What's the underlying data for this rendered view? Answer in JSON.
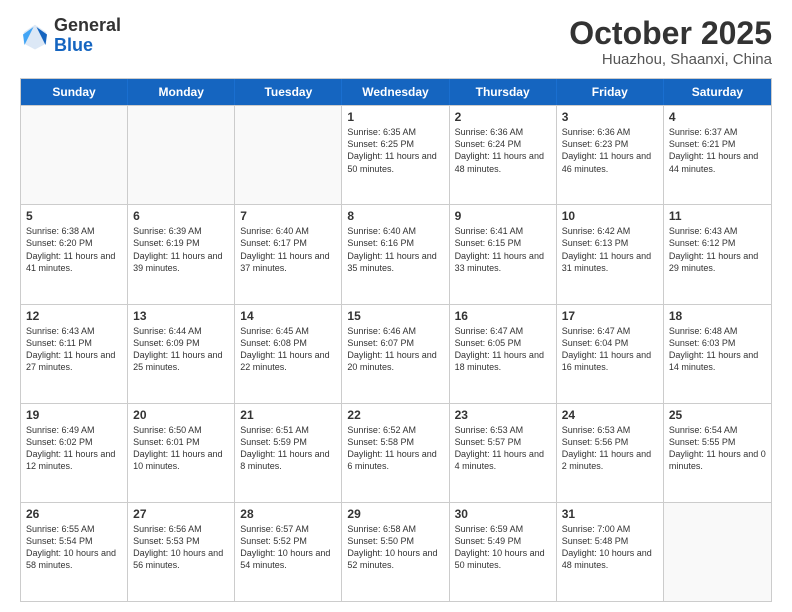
{
  "logo": {
    "general": "General",
    "blue": "Blue"
  },
  "title": "October 2025",
  "location": "Huazhou, Shaanxi, China",
  "days_of_week": [
    "Sunday",
    "Monday",
    "Tuesday",
    "Wednesday",
    "Thursday",
    "Friday",
    "Saturday"
  ],
  "weeks": [
    [
      {
        "day": "",
        "info": ""
      },
      {
        "day": "",
        "info": ""
      },
      {
        "day": "",
        "info": ""
      },
      {
        "day": "1",
        "info": "Sunrise: 6:35 AM\nSunset: 6:25 PM\nDaylight: 11 hours and 50 minutes."
      },
      {
        "day": "2",
        "info": "Sunrise: 6:36 AM\nSunset: 6:24 PM\nDaylight: 11 hours and 48 minutes."
      },
      {
        "day": "3",
        "info": "Sunrise: 6:36 AM\nSunset: 6:23 PM\nDaylight: 11 hours and 46 minutes."
      },
      {
        "day": "4",
        "info": "Sunrise: 6:37 AM\nSunset: 6:21 PM\nDaylight: 11 hours and 44 minutes."
      }
    ],
    [
      {
        "day": "5",
        "info": "Sunrise: 6:38 AM\nSunset: 6:20 PM\nDaylight: 11 hours and 41 minutes."
      },
      {
        "day": "6",
        "info": "Sunrise: 6:39 AM\nSunset: 6:19 PM\nDaylight: 11 hours and 39 minutes."
      },
      {
        "day": "7",
        "info": "Sunrise: 6:40 AM\nSunset: 6:17 PM\nDaylight: 11 hours and 37 minutes."
      },
      {
        "day": "8",
        "info": "Sunrise: 6:40 AM\nSunset: 6:16 PM\nDaylight: 11 hours and 35 minutes."
      },
      {
        "day": "9",
        "info": "Sunrise: 6:41 AM\nSunset: 6:15 PM\nDaylight: 11 hours and 33 minutes."
      },
      {
        "day": "10",
        "info": "Sunrise: 6:42 AM\nSunset: 6:13 PM\nDaylight: 11 hours and 31 minutes."
      },
      {
        "day": "11",
        "info": "Sunrise: 6:43 AM\nSunset: 6:12 PM\nDaylight: 11 hours and 29 minutes."
      }
    ],
    [
      {
        "day": "12",
        "info": "Sunrise: 6:43 AM\nSunset: 6:11 PM\nDaylight: 11 hours and 27 minutes."
      },
      {
        "day": "13",
        "info": "Sunrise: 6:44 AM\nSunset: 6:09 PM\nDaylight: 11 hours and 25 minutes."
      },
      {
        "day": "14",
        "info": "Sunrise: 6:45 AM\nSunset: 6:08 PM\nDaylight: 11 hours and 22 minutes."
      },
      {
        "day": "15",
        "info": "Sunrise: 6:46 AM\nSunset: 6:07 PM\nDaylight: 11 hours and 20 minutes."
      },
      {
        "day": "16",
        "info": "Sunrise: 6:47 AM\nSunset: 6:05 PM\nDaylight: 11 hours and 18 minutes."
      },
      {
        "day": "17",
        "info": "Sunrise: 6:47 AM\nSunset: 6:04 PM\nDaylight: 11 hours and 16 minutes."
      },
      {
        "day": "18",
        "info": "Sunrise: 6:48 AM\nSunset: 6:03 PM\nDaylight: 11 hours and 14 minutes."
      }
    ],
    [
      {
        "day": "19",
        "info": "Sunrise: 6:49 AM\nSunset: 6:02 PM\nDaylight: 11 hours and 12 minutes."
      },
      {
        "day": "20",
        "info": "Sunrise: 6:50 AM\nSunset: 6:01 PM\nDaylight: 11 hours and 10 minutes."
      },
      {
        "day": "21",
        "info": "Sunrise: 6:51 AM\nSunset: 5:59 PM\nDaylight: 11 hours and 8 minutes."
      },
      {
        "day": "22",
        "info": "Sunrise: 6:52 AM\nSunset: 5:58 PM\nDaylight: 11 hours and 6 minutes."
      },
      {
        "day": "23",
        "info": "Sunrise: 6:53 AM\nSunset: 5:57 PM\nDaylight: 11 hours and 4 minutes."
      },
      {
        "day": "24",
        "info": "Sunrise: 6:53 AM\nSunset: 5:56 PM\nDaylight: 11 hours and 2 minutes."
      },
      {
        "day": "25",
        "info": "Sunrise: 6:54 AM\nSunset: 5:55 PM\nDaylight: 11 hours and 0 minutes."
      }
    ],
    [
      {
        "day": "26",
        "info": "Sunrise: 6:55 AM\nSunset: 5:54 PM\nDaylight: 10 hours and 58 minutes."
      },
      {
        "day": "27",
        "info": "Sunrise: 6:56 AM\nSunset: 5:53 PM\nDaylight: 10 hours and 56 minutes."
      },
      {
        "day": "28",
        "info": "Sunrise: 6:57 AM\nSunset: 5:52 PM\nDaylight: 10 hours and 54 minutes."
      },
      {
        "day": "29",
        "info": "Sunrise: 6:58 AM\nSunset: 5:50 PM\nDaylight: 10 hours and 52 minutes."
      },
      {
        "day": "30",
        "info": "Sunrise: 6:59 AM\nSunset: 5:49 PM\nDaylight: 10 hours and 50 minutes."
      },
      {
        "day": "31",
        "info": "Sunrise: 7:00 AM\nSunset: 5:48 PM\nDaylight: 10 hours and 48 minutes."
      },
      {
        "day": "",
        "info": ""
      }
    ]
  ]
}
